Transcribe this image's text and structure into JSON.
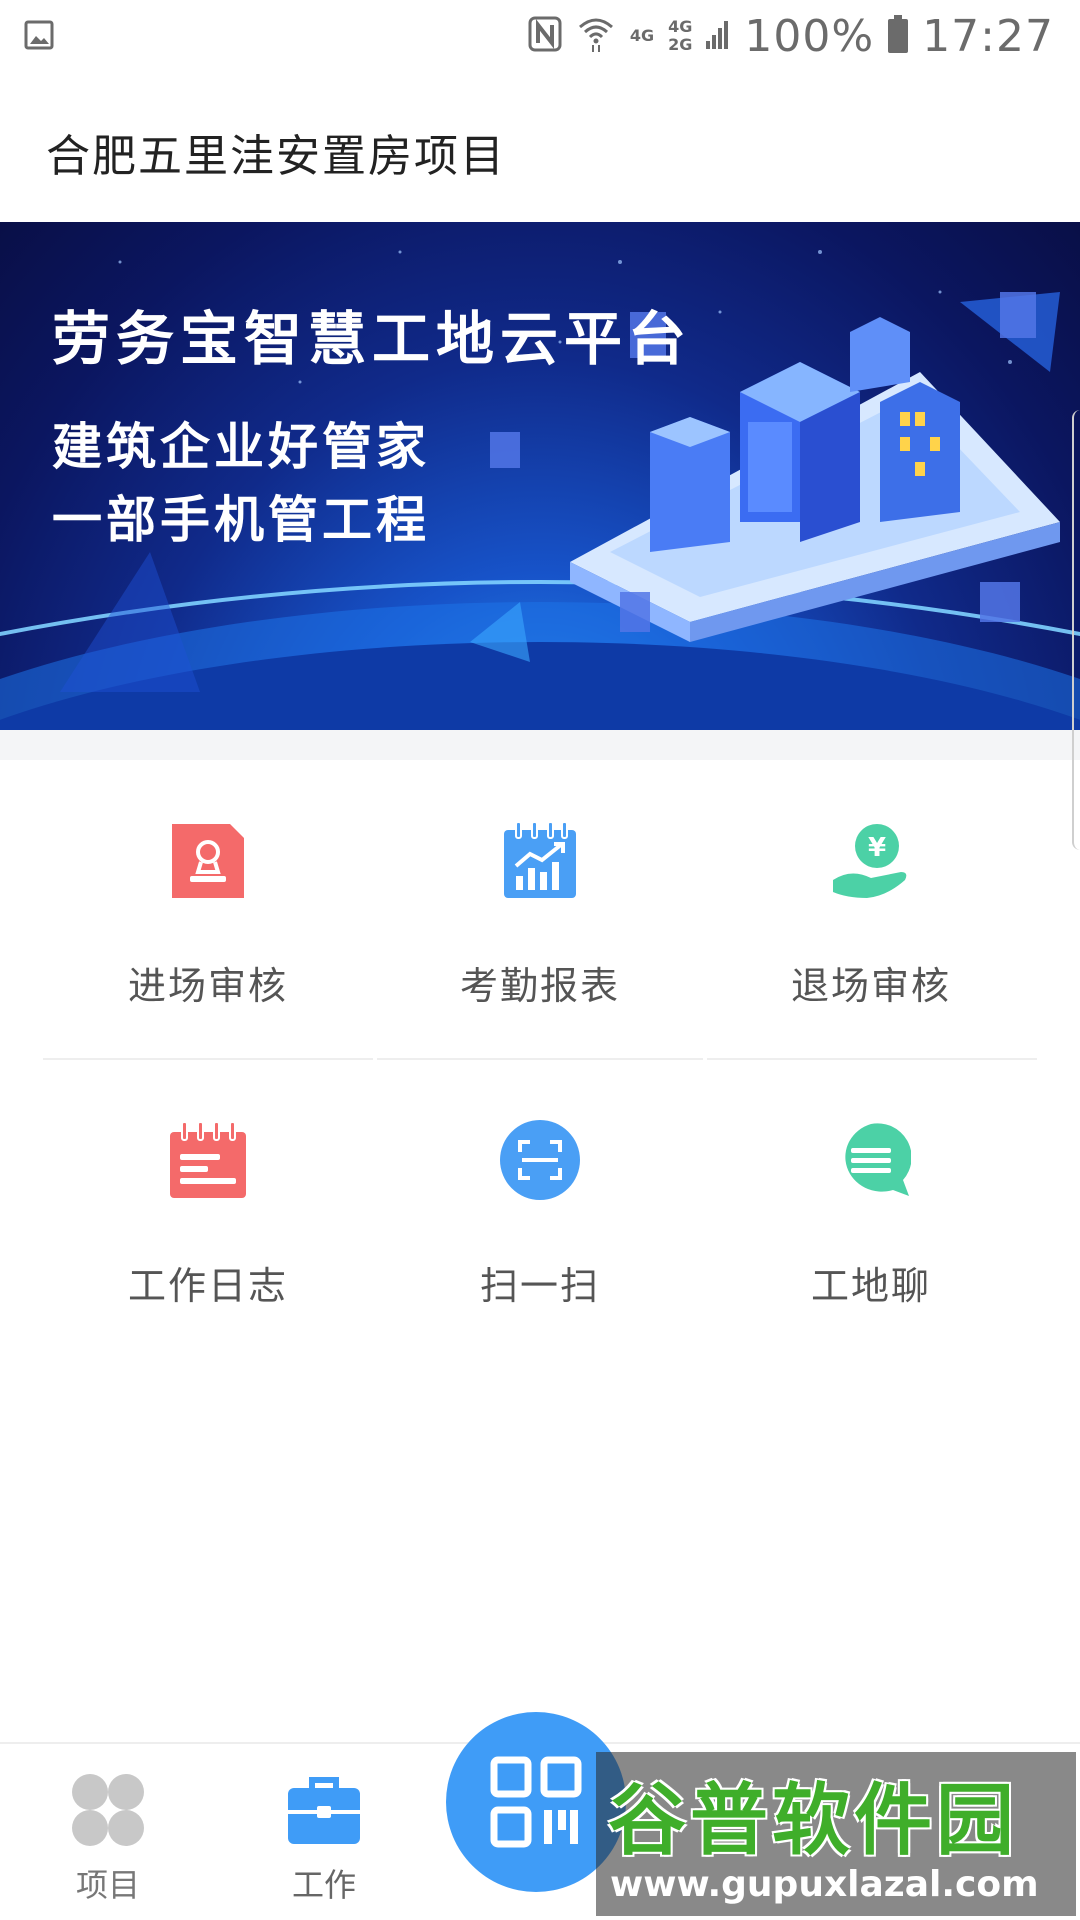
{
  "status_bar": {
    "battery": "100%",
    "time": "17:27",
    "net1": "4G",
    "net2": "4G",
    "net3": "2G",
    "icons": [
      "gallery-icon",
      "nfc-icon",
      "wifi-icon",
      "signal-icon",
      "battery-icon"
    ]
  },
  "header": {
    "title": "合肥五里洼安置房项目"
  },
  "banner": {
    "title": "劳务宝智慧工地云平台",
    "line1": "建筑企业好管家",
    "line2": "一部手机管工程"
  },
  "grid": {
    "items": [
      {
        "label": "进场审核",
        "icon": "entry-review-icon",
        "color": "#f46a6a"
      },
      {
        "label": "考勤报表",
        "icon": "attendance-report-icon",
        "color": "#4a9ff5"
      },
      {
        "label": "退场审核",
        "icon": "exit-review-icon",
        "color": "#4cd1a6"
      },
      {
        "label": "工作日志",
        "icon": "work-log-icon",
        "color": "#f46a6a"
      },
      {
        "label": "扫一扫",
        "icon": "scan-icon",
        "color": "#4a9ff5"
      },
      {
        "label": "工地聊",
        "icon": "site-chat-icon",
        "color": "#4cd1a6"
      }
    ]
  },
  "bottom_nav": {
    "items": [
      {
        "label": "项目",
        "icon": "project-grid-icon",
        "active": false
      },
      {
        "label": "工作",
        "icon": "briefcase-icon",
        "active": true
      }
    ],
    "fab_icon": "qr-code-icon",
    "active_color": "#3f9cf7",
    "inactive_color": "#999999"
  },
  "watermark": {
    "text": "谷普软件园",
    "url": "www.gupuxlazal.com"
  }
}
